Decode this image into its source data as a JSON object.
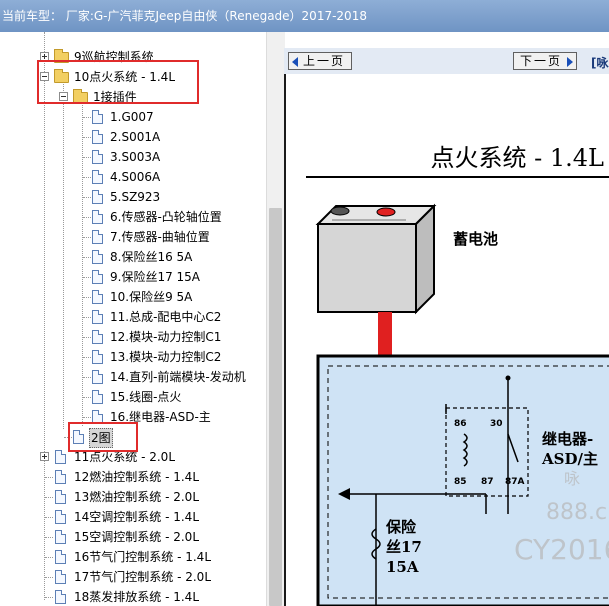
{
  "header": {
    "text": "当前车型： 厂家:G-广汽菲克Jeep自由侠（Renegade）2017-2018"
  },
  "tree": {
    "folder_9": "9巡航控制系统",
    "folder_10": "10点火系统 - 1.4L",
    "folder_connectors": "1接插件",
    "connectors": [
      "1.G007",
      "2.S001A",
      "3.S003A",
      "4.S006A",
      "5.SZ923",
      "6.传感器-凸轮轴位置",
      "7.传感器-曲轴位置",
      "8.保险丝16 5A",
      "9.保险丝17 15A",
      "10.保险丝9 5A",
      "11.总成-配电中心C2",
      "12.模块-动力控制C1",
      "13.模块-动力控制C2",
      "14.直列-前端模块-发动机",
      "15.线圈-点火",
      "16.继电器-ASD-主"
    ],
    "diagram_item": "2图",
    "systems": [
      "11点火系统 - 2.0L",
      "12燃油控制系统 - 1.4L",
      "13燃油控制系统 - 2.0L",
      "14空调控制系统 - 1.4L",
      "15空调控制系统 - 2.0L",
      "16节气门控制系统 - 1.4L",
      "17节气门控制系统 - 2.0L",
      "18蒸发排放系统 - 1.4L"
    ]
  },
  "viewer": {
    "prev_label": "上一页",
    "next_label": "下一页",
    "partial_label": "[咏",
    "diagram": {
      "title": "点火系统 - 1.4L",
      "battery_label": "蓄电池",
      "relay_label_1": "继电器-",
      "relay_label_2": "ASD/主",
      "relay_pins": [
        "86",
        "30",
        "85",
        "87",
        "87A"
      ],
      "fuse_label_1": "保险",
      "fuse_label_2": "丝17",
      "fuse_label_3": "15A",
      "watermark_1": "咏",
      "watermark_2": "888.c",
      "watermark_3": "CY2016"
    }
  },
  "colors": {
    "header_bg": "#7a9cc9",
    "highlight_box": "#e02b2b",
    "battery_cable": "#e02020",
    "fuse_panel_bg": "#cfe3f5"
  }
}
